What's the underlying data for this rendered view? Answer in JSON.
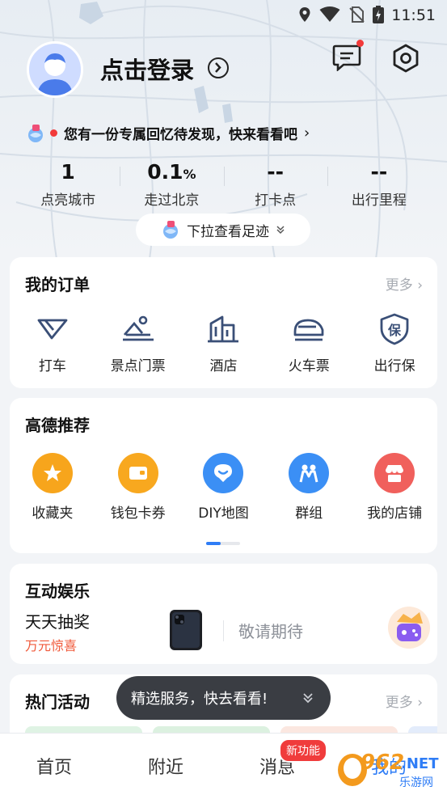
{
  "status_bar": {
    "time": "11:51"
  },
  "profile": {
    "login_label": "点击登录"
  },
  "memory_banner": {
    "text": "您有一份专属回忆待发现，快来看看吧"
  },
  "stats": [
    {
      "value": "1",
      "unit": "",
      "label": "点亮城市"
    },
    {
      "value": "0.1",
      "unit": "%",
      "label": "走过北京"
    },
    {
      "value": "--",
      "unit": "",
      "label": "打卡点"
    },
    {
      "value": "--",
      "unit": "",
      "label": "出行里程"
    }
  ],
  "pull_hint": "下拉查看足迹",
  "orders": {
    "title": "我的订单",
    "more": "更多",
    "items": [
      {
        "label": "打车",
        "icon": "taxi-icon"
      },
      {
        "label": "景点门票",
        "icon": "scenic-ticket-icon"
      },
      {
        "label": "酒店",
        "icon": "hotel-icon"
      },
      {
        "label": "火车票",
        "icon": "train-icon"
      },
      {
        "label": "出行保",
        "icon": "insurance-shield-icon"
      }
    ]
  },
  "recommend": {
    "title": "高德推荐",
    "items": [
      {
        "label": "收藏夹",
        "icon": "star-icon",
        "color": "#f7a51c"
      },
      {
        "label": "钱包卡券",
        "icon": "wallet-icon",
        "color": "#f8a81f"
      },
      {
        "label": "DIY地图",
        "icon": "diy-map-icon",
        "color": "#3b8ff5"
      },
      {
        "label": "群组",
        "icon": "group-icon",
        "color": "#3b8ff5"
      },
      {
        "label": "我的店铺",
        "icon": "shop-icon",
        "color": "#f0605c"
      }
    ]
  },
  "entertainment": {
    "title": "互动娱乐",
    "lottery_title": "天天抽奖",
    "lottery_sub": "万元惊喜",
    "coming": "敬请期待"
  },
  "activities": {
    "title": "热门活动",
    "more": "更多"
  },
  "toast": {
    "text": "精选服务，快去看看!"
  },
  "bottom_nav": {
    "tabs": [
      "首页",
      "附近",
      "消息",
      "我的"
    ],
    "badge": "新功能"
  },
  "watermark": {
    "main": "962",
    "net": ".NET",
    "sub": "乐游网"
  },
  "colors": {
    "accent": "#2f7df6",
    "badge": "#f03c3c",
    "orange_text": "#f0593a"
  }
}
